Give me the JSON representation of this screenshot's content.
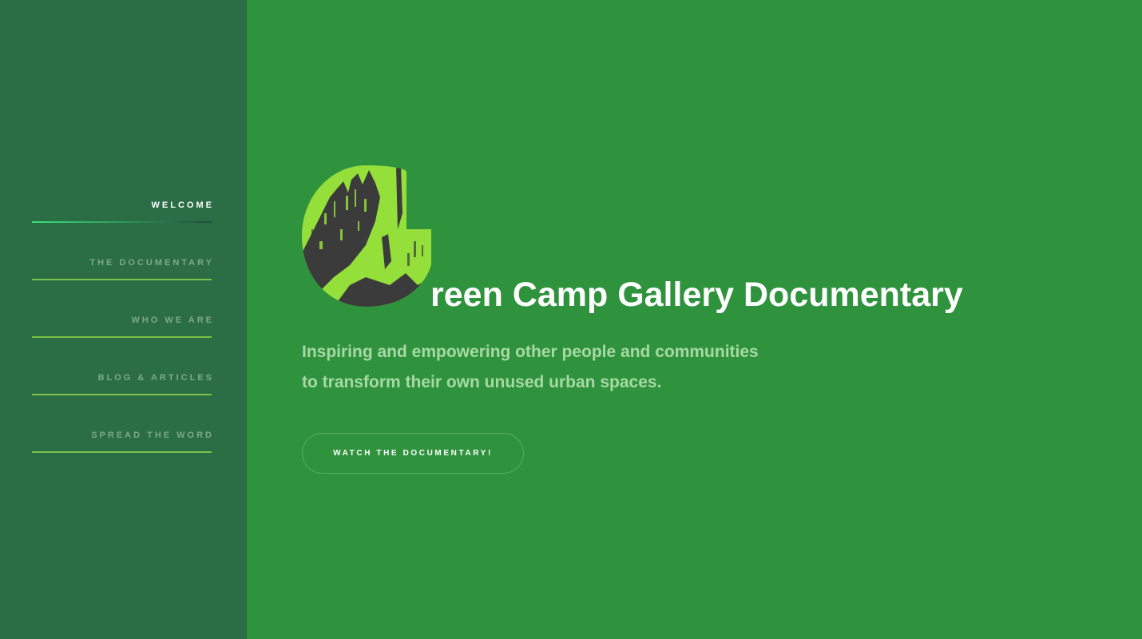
{
  "colors": {
    "page_bg": "#2f933e",
    "sidebar_bg": "#2b6d45",
    "logo_green": "#94df3a",
    "logo_dark": "#3b3b3b",
    "nav_inactive": "#7fa98a",
    "nav_line": "#7cc24a",
    "tagline": "#a7d9a5"
  },
  "sidebar": {
    "items": [
      {
        "label": "WELCOME",
        "active": true
      },
      {
        "label": "THE DOCUMENTARY",
        "active": false
      },
      {
        "label": "WHO WE ARE",
        "active": false
      },
      {
        "label": "BLOG & ARTICLES",
        "active": false
      },
      {
        "label": "SPREAD THE WORD",
        "active": false
      }
    ]
  },
  "hero": {
    "logo_icon": "letter-g-logo-icon",
    "title": "reen Camp Gallery Documentary",
    "tagline_line1": "Inspiring and empowering other people and communities",
    "tagline_line2": "to transform their own unused urban spaces.",
    "cta_label": "WATCH THE DOCUMENTARY!"
  }
}
